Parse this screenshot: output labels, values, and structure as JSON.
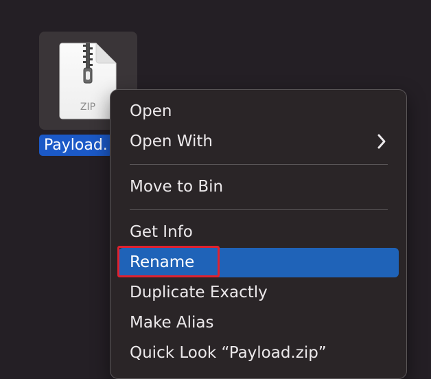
{
  "desktop": {
    "file": {
      "icon": "zip-archive-icon",
      "badge": "ZIP",
      "label": "Payload."
    }
  },
  "context_menu": {
    "items": [
      {
        "label": "Open"
      },
      {
        "label": "Open With",
        "submenu_icon": "chevron-right-icon"
      },
      {
        "label": "Move to Bin"
      },
      {
        "label": "Get Info"
      },
      {
        "label": "Rename",
        "highlighted": true
      },
      {
        "label": "Duplicate Exactly"
      },
      {
        "label": "Make Alias"
      },
      {
        "label": "Quick Look “Payload.zip”"
      }
    ]
  },
  "colors": {
    "desktop_background": "#241f25",
    "menu_background": "#2a2527",
    "selection_blue": "#1f63b8",
    "focus_outline_red": "#e0212f"
  }
}
